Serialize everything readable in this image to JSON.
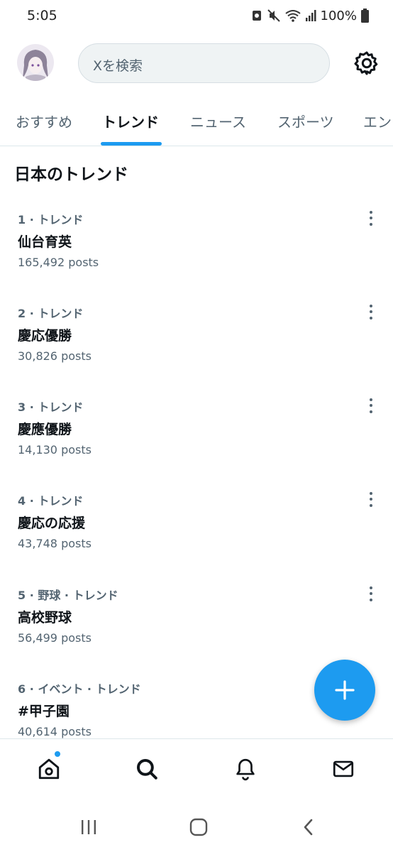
{
  "status_bar": {
    "time": "5:05",
    "battery": "100%"
  },
  "header": {
    "search_placeholder": "Xを検索"
  },
  "tabs": [
    {
      "label": "おすすめ"
    },
    {
      "label": "トレンド"
    },
    {
      "label": "ニュース"
    },
    {
      "label": "スポーツ"
    },
    {
      "label": "エンタ"
    }
  ],
  "section_title": "日本のトレンド",
  "trends": [
    {
      "meta": "1 · トレンド",
      "name": "仙台育英",
      "posts": "165,492 posts"
    },
    {
      "meta": "2 · トレンド",
      "name": "慶応優勝",
      "posts": "30,826 posts"
    },
    {
      "meta": "3 · トレンド",
      "name": "慶應優勝",
      "posts": "14,130 posts"
    },
    {
      "meta": "4 · トレンド",
      "name": "慶応の応援",
      "posts": "43,748 posts"
    },
    {
      "meta": "5 · 野球 · トレンド",
      "name": "高校野球",
      "posts": "56,499 posts"
    },
    {
      "meta": "6 · イベント · トレンド",
      "name": "#甲子園",
      "posts": "40,614 posts"
    }
  ],
  "colors": {
    "accent": "#1d9bf0",
    "text_primary": "#0f1419",
    "text_secondary": "#536471"
  },
  "icons": {
    "settings": "gear-icon",
    "compose": "plus-icon",
    "nav": [
      "home-icon",
      "search-icon",
      "bell-icon",
      "mail-icon"
    ],
    "system": [
      "recents-icon",
      "home-circle-icon",
      "back-icon"
    ]
  }
}
